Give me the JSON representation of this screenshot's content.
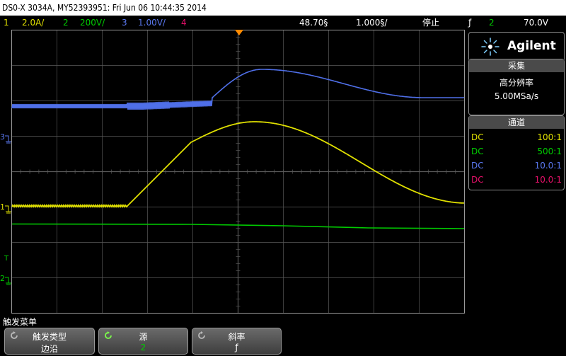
{
  "title_bar": {
    "text": "DS0-X 3034A, MY52393951: Fri Jun 06 10:44:35 2014"
  },
  "status_bar": {
    "ch1_num": "1",
    "ch1_scale": "2.0A/",
    "ch2_num": "2",
    "ch2_scale": "200V/",
    "ch3_num": "3",
    "ch3_scale": "1.00V/",
    "ch4_num": "4",
    "time_delay": "48.70§",
    "time_scale": "1.000§/",
    "run_state": "停止",
    "trigger_icon": "ƒ",
    "trigger_channel": "2",
    "trigger_level": "70.0V"
  },
  "colors": {
    "ch1": "#e0e000",
    "ch2": "#00cc00",
    "ch3": "#4f6fe8",
    "ch4": "#e8106a",
    "trigger_marker": "#ff8a00",
    "grid": "#5a5a5a",
    "panel_header": "#4a4a4a"
  },
  "side_panel": {
    "brand": "Agilent",
    "acq_header": "采集",
    "acq_mode": "高分辨率",
    "sample_rate": "5.00MSa/s",
    "channels_header": "通道",
    "channels": [
      {
        "coupling": "DC",
        "ratio": "100:1"
      },
      {
        "coupling": "DC",
        "ratio": "500:1"
      },
      {
        "coupling": "DC",
        "ratio": "10.0:1"
      },
      {
        "coupling": "DC",
        "ratio": "10.0:1"
      }
    ]
  },
  "markers": {
    "ch3_ground": "3",
    "ch1_ground": "1",
    "trigger_level": "T",
    "ch2_ground": "2"
  },
  "softkey_menu": {
    "title": "触发菜单",
    "keys": [
      {
        "label": "触发类型",
        "value": "边沿"
      },
      {
        "label": "源",
        "value": "2"
      },
      {
        "label": "斜率",
        "value": "ƒ"
      }
    ]
  }
}
